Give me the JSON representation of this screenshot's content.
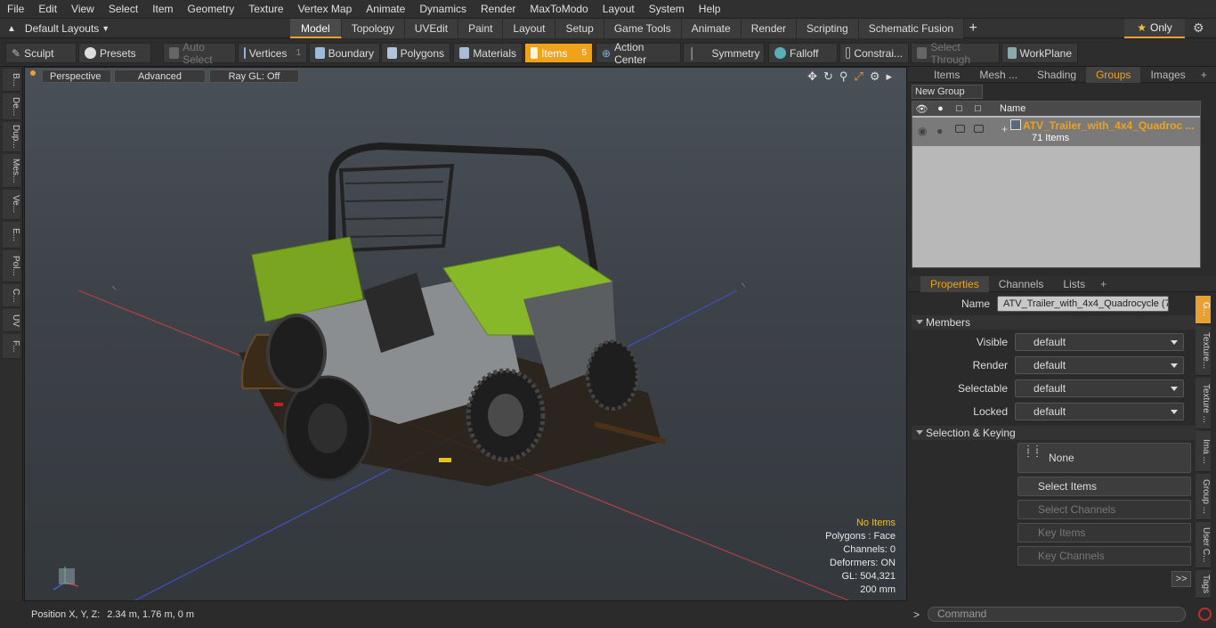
{
  "menu": [
    "File",
    "Edit",
    "View",
    "Select",
    "Item",
    "Geometry",
    "Texture",
    "Vertex Map",
    "Animate",
    "Dynamics",
    "Render",
    "MaxToModo",
    "Layout",
    "System",
    "Help"
  ],
  "layouts_label": "Default Layouts",
  "mode_tabs": [
    "Model",
    "Topology",
    "UVEdit",
    "Paint",
    "Layout",
    "Setup",
    "Game Tools",
    "Animate",
    "Render",
    "Scripting",
    "Schematic Fusion"
  ],
  "active_mode": "Model",
  "only_label": "Only",
  "toolbar": {
    "sculpt": "Sculpt",
    "presets": "Presets",
    "auto_select": "Auto Select",
    "vertices": "Vertices",
    "vertices_count": "1",
    "boundary": "Boundary",
    "polygons": "Polygons",
    "materials": "Materials",
    "items": "Items",
    "items_count": "5",
    "action_center": "Action Center",
    "symmetry": "Symmetry",
    "falloff": "Falloff",
    "constraints": "Constrai...",
    "select_through": "Select Through",
    "workplane": "WorkPlane"
  },
  "left_tabs": [
    "B...",
    "De...",
    "Dup...",
    "Mes...",
    "Ve...",
    "E...",
    "Pol...",
    "C...",
    "UV",
    "F..."
  ],
  "viewport": {
    "perspective": "Perspective",
    "advanced": "Advanced",
    "raygl": "Ray GL: Off",
    "info": {
      "no_items": "No Items",
      "polygons": "Polygons : Face",
      "channels": "Channels: 0",
      "deformers": "Deformers: ON",
      "gl": "GL: 504,321",
      "scale": "200 mm"
    }
  },
  "status": {
    "label": "Position X, Y, Z:",
    "value": "2.34 m, 1.76 m, 0 m"
  },
  "top_panel_tabs": [
    "Items",
    "Mesh ...",
    "Shading",
    "Groups",
    "Images"
  ],
  "top_panel_active": "Groups",
  "new_group": "New Group",
  "group_header_name": "Name",
  "group": {
    "name": "ATV_Trailer_with_4x4_Quadroc ...",
    "count": "71 Items"
  },
  "prop_tabs": [
    "Properties",
    "Channels",
    "Lists"
  ],
  "prop_active": "Properties",
  "props": {
    "name_label": "Name",
    "name_value": "ATV_Trailer_with_4x4_Quadrocycle (7",
    "members": "Members",
    "visible_label": "Visible",
    "visible_value": "default",
    "render_label": "Render",
    "render_value": "default",
    "selectable_label": "Selectable",
    "selectable_value": "default",
    "locked_label": "Locked",
    "locked_value": "default",
    "sel_keying": "Selection & Keying",
    "none": "None",
    "select_items": "Select Items",
    "select_channels": "Select Channels",
    "key_items": "Key Items",
    "key_channels": "Key Channels",
    "more": ">>"
  },
  "right_side_tabs": [
    "G...",
    "Texture...",
    "Texture ...",
    "Ima ...",
    "Group ...",
    "User C...",
    "Tags"
  ],
  "command_placeholder": "Command"
}
